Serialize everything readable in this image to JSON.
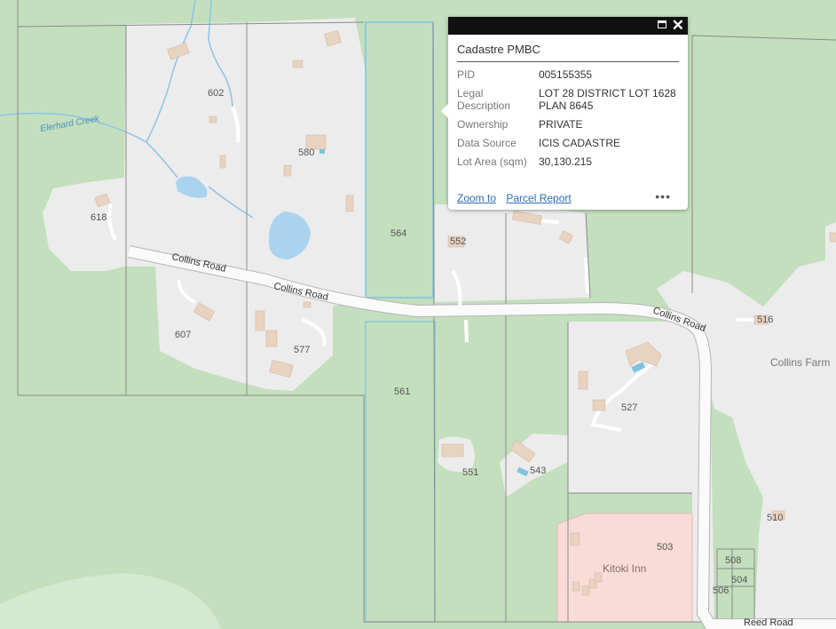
{
  "map": {
    "parcel_labels": [
      "602",
      "580",
      "618",
      "564",
      "552",
      "607",
      "577",
      "561",
      "527",
      "551",
      "543",
      "516",
      "510",
      "503",
      "508",
      "504",
      "506"
    ],
    "roads": [
      "Collins Road",
      "Collins Road",
      "Collins Road",
      "Reed Road"
    ],
    "creek": "Elerhard Creek",
    "places": [
      "Collins Farm",
      "Kitoki Inn"
    ],
    "colors": {
      "vegetation": "#c3dfbd",
      "developed": "#ececec",
      "water": "#a9d3ee",
      "building": "#e8d2c0",
      "inn": "#f9dcd8",
      "parcel_line": "#8a8a8a",
      "selected_parcel": "#7ec3e0"
    }
  },
  "popup": {
    "title": "Cadastre PMBC",
    "fields": [
      {
        "key": "PID",
        "value": "005155355"
      },
      {
        "key": "Legal Description",
        "value": "LOT 28 DISTRICT LOT 1628 PLAN 8645"
      },
      {
        "key": "Ownership",
        "value": "PRIVATE"
      },
      {
        "key": "Data Source",
        "value": "ICIS CADASTRE"
      },
      {
        "key": "Lot Area (sqm)",
        "value": "30,130.215"
      }
    ],
    "actions": {
      "zoom": "Zoom to",
      "report": "Parcel Report"
    },
    "more_icon": "ellipsis-icon",
    "maximize_icon": "maximize-icon",
    "close_icon": "close-icon",
    "close_glyph": "✕",
    "more_glyph": "•••"
  }
}
